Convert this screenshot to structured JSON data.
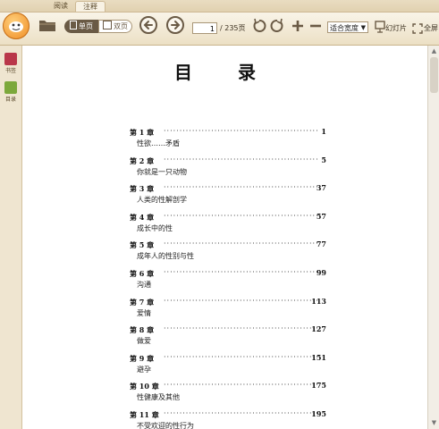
{
  "tabs": [
    {
      "label": "阅读",
      "active": false
    },
    {
      "label": "注释",
      "active": true
    }
  ],
  "toolbar": {
    "single_page_label": "单页",
    "double_page_label": "双页",
    "current_page": "1",
    "total_pages": "/ 235页",
    "zoom_value": "适合宽度",
    "slideshow_label": "幻灯片",
    "fullscreen_label": "全屏"
  },
  "left_panel": {
    "items": [
      {
        "label": "书签",
        "icon": "bookmark-icon"
      },
      {
        "label": "目录",
        "icon": "toc-icon"
      }
    ]
  },
  "document": {
    "title": "目 录",
    "entries": [
      {
        "chapter": "第 1 章",
        "page": "1",
        "subtitle": "性欲……矛盾"
      },
      {
        "chapter": "第 2 章",
        "page": "5",
        "subtitle": "你就是一只动物"
      },
      {
        "chapter": "第 3 章",
        "page": "37",
        "subtitle": "人类的性解剖学"
      },
      {
        "chapter": "第 4 章",
        "page": "57",
        "subtitle": "成长中的性"
      },
      {
        "chapter": "第 5 章",
        "page": "77",
        "subtitle": "成年人的性别与性"
      },
      {
        "chapter": "第 6 章",
        "page": "99",
        "subtitle": "沟通"
      },
      {
        "chapter": "第 7 章",
        "page": "113",
        "subtitle": "爱情"
      },
      {
        "chapter": "第 8 章",
        "page": "127",
        "subtitle": "做爱"
      },
      {
        "chapter": "第 9 章",
        "page": "151",
        "subtitle": "避孕"
      },
      {
        "chapter": "第 10 章",
        "page": "175",
        "subtitle": "性健康及其他"
      },
      {
        "chapter": "第 11 章",
        "page": "195",
        "subtitle": "不受欢迎的性行为"
      }
    ]
  },
  "colors": {
    "accent_orange": "#ee8a22",
    "toolbar_bg": "#f3ead8",
    "segment_dark": "#6a5a45"
  }
}
